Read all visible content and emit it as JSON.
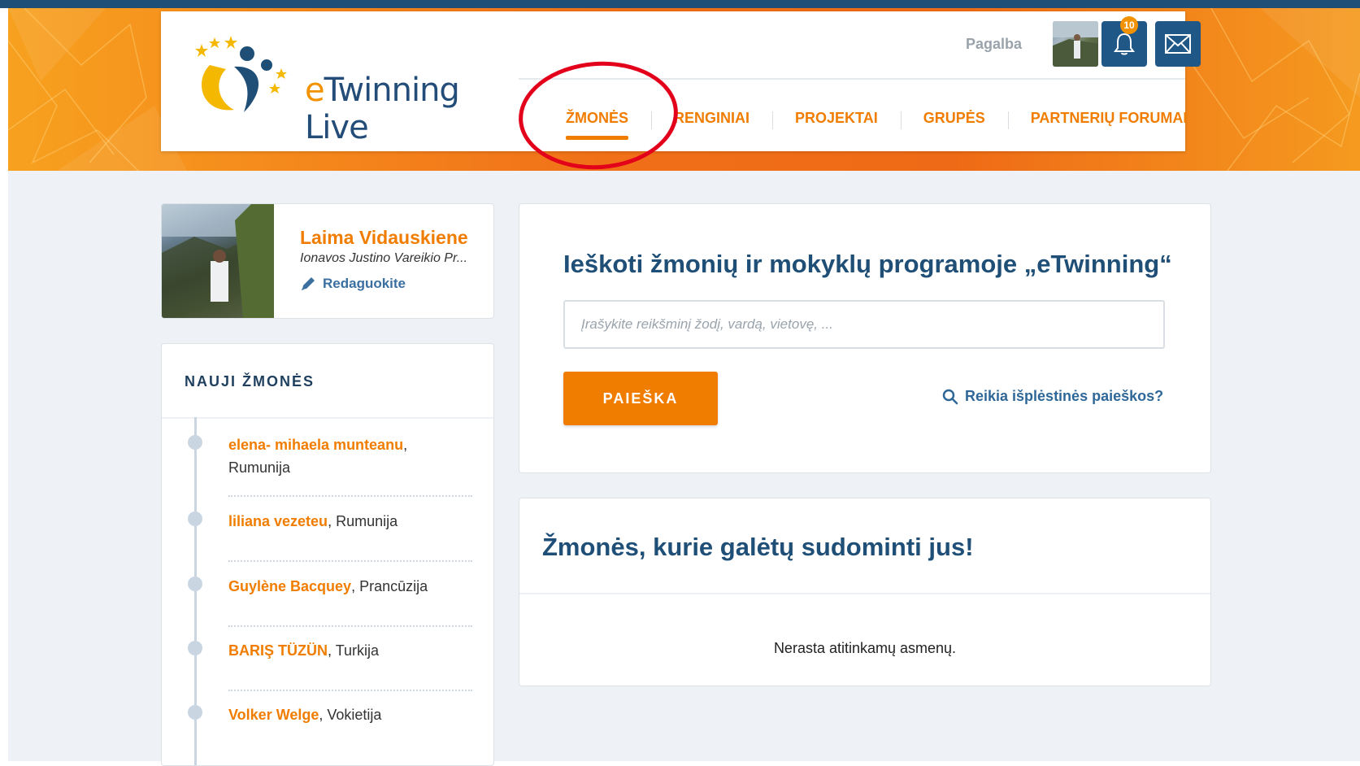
{
  "header": {
    "logo_text_e": "e",
    "logo_text_rest": "Twinning Live",
    "help_label": "Pagalba",
    "notification_count": "10"
  },
  "nav": {
    "items": [
      {
        "label": "ŽMONĖS",
        "active": true
      },
      {
        "label": "RENGINIAI",
        "active": false
      },
      {
        "label": "PROJEKTAI",
        "active": false
      },
      {
        "label": "GRUPĖS",
        "active": false
      },
      {
        "label": "PARTNERIŲ FORUMAI",
        "active": false
      }
    ]
  },
  "profile": {
    "name": "Laima Vidauskiene",
    "school": "Ionavos Justino Vareikio Pr...",
    "edit_label": "Redaguokite"
  },
  "new_people": {
    "title": "NAUJI ŽMONĖS",
    "items": [
      {
        "name": "elena- mihaela munteanu",
        "country": "Rumunija"
      },
      {
        "name": "liliana vezeteu",
        "country": "Rumunija"
      },
      {
        "name": "Guylène Bacquey",
        "country": "Prancūzija"
      },
      {
        "name": "BARIŞ TÜZÜN",
        "country": "Turkija"
      },
      {
        "name": "Volker Welge",
        "country": "Vokietija"
      }
    ]
  },
  "search": {
    "title": "Ieškoti žmonių ir mokyklų programoje „eTwinning“",
    "placeholder": "Įrašykite reikšminį žodį, vardą, vietovę, ...",
    "button_label": "PAIEŠKA",
    "advanced_label": "Reikia išplėstinės paieškos?"
  },
  "suggestions": {
    "title": "Žmonės, kurie galėtų sudominti jus!",
    "empty_text": "Nerasta atitinkamų asmenų."
  },
  "colors": {
    "accent": "#f07d00",
    "brand_blue": "#1f4f77",
    "annotation_red": "#e3001b"
  }
}
